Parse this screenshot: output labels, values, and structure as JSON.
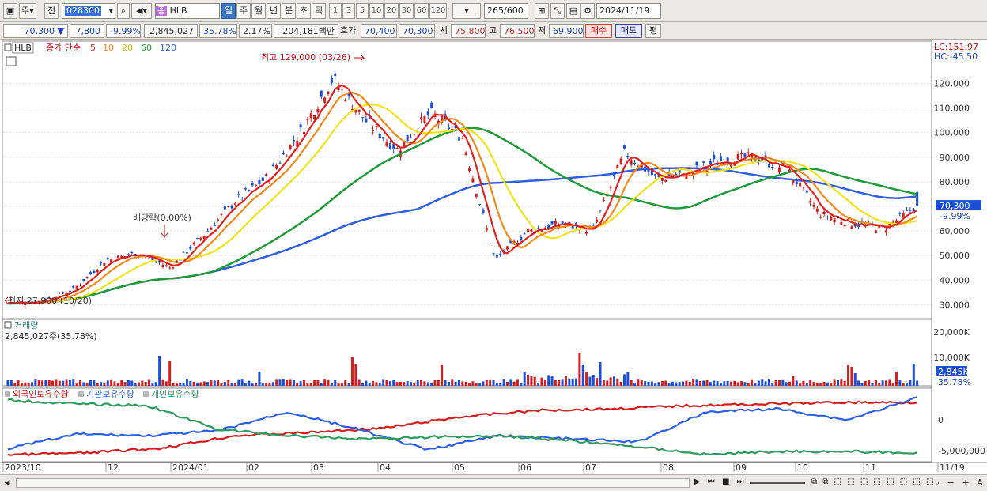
{
  "toolbar": {
    "period_select": "주",
    "prev_label": "전",
    "stock_code": "028300",
    "stock_badge": "종",
    "stock_name": "HLB",
    "tabs": [
      "일",
      "주",
      "월",
      "년",
      "분",
      "초",
      "틱"
    ],
    "active_tab": "일",
    "intervals": [
      "1",
      "3",
      "5",
      "10",
      "20",
      "30",
      "60",
      "120"
    ],
    "count": "265",
    "count_total": "/600",
    "date": "2024/11/19"
  },
  "quote": {
    "price": "70,300",
    "change": "7,800",
    "change_pct": "-9.99%",
    "volume": "2,845,027",
    "vol_ratio": "35.78%",
    "turnover_rate": "2.17%",
    "amount": "204,181백만",
    "bid_label": "호가",
    "bid1": "70,400",
    "bid2": "70,300",
    "open_label": "시",
    "open": "75,800",
    "high_label": "고",
    "high": "76,500",
    "low_label": "저",
    "low": "69,900",
    "buy_label": "매수",
    "sell_label": "매도",
    "avg_label": "평"
  },
  "main_legend": {
    "name": "HLB",
    "ma_title": "종가 단순",
    "ma_periods": [
      "5",
      "10",
      "20",
      "60",
      "120"
    ]
  },
  "colors": {
    "up": "#d21e1e",
    "down": "#1b4fd8",
    "ma5": "#e02020",
    "ma10": "#f08a1a",
    "ma20": "#f2e21a",
    "ma60": "#1f9a3a",
    "ma120": "#2f5fe0",
    "foreign": "#d21e1e",
    "inst": "#2f5fe0",
    "indiv": "#2e9a5e"
  },
  "annotations": {
    "high": "최고 129,000 (03/26)",
    "low": "최저 27,900 (10/20)",
    "dividend": "배당락(0.00%)"
  },
  "price_axis": {
    "lc": "LC:151.97",
    "hc": "HC:-45.50",
    "ticks": [
      "120,000",
      "110,000",
      "100,000",
      "90,000",
      "80,000",
      "70,000",
      "60,000",
      "50,000",
      "40,000",
      "30,000"
    ],
    "current": "70,300",
    "current_pct": "-9.99%"
  },
  "volume_panel": {
    "title": "거래량",
    "value": "2,845,027주(35.78%)",
    "ticks": [
      "20,000K",
      "10,000K"
    ],
    "current": "2,845K",
    "current_pct": "35.78%"
  },
  "holding_panel": {
    "legend": [
      "외국인보유수량",
      "기관보유수량",
      "개인보유수량"
    ],
    "ticks": [
      "0",
      "-5,000,000"
    ]
  },
  "x_axis": [
    "2023/10",
    "12",
    "2024/01",
    "02",
    "03",
    "04",
    "05",
    "06",
    "07",
    "08",
    "09",
    "10",
    "11",
    "11/19"
  ],
  "chart_data": {
    "type": "line",
    "title": "HLB",
    "series_type": "candlestick",
    "ylim": [
      25000,
      133000
    ],
    "high": {
      "value": 129000,
      "date": "03/26"
    },
    "low": {
      "value": 27900,
      "date": "10/20"
    },
    "close_path": [
      [
        "2023/10",
        30500
      ],
      [
        "2023/11",
        31500
      ],
      [
        "2023/12",
        36000
      ],
      [
        "2023/12-b",
        48000
      ],
      [
        "2024/01",
        51000
      ],
      [
        "2024/01-b",
        45000
      ],
      [
        "2024/02",
        58000
      ],
      [
        "2024/02-b",
        72000
      ],
      [
        "2024/03",
        82000
      ],
      [
        "2024/03-b",
        100000
      ],
      [
        "2024/03/26",
        122000
      ],
      [
        "2024/04",
        105000
      ],
      [
        "2024/04-b",
        93000
      ],
      [
        "2024/05",
        108000
      ],
      [
        "2024/05-b",
        98000
      ],
      [
        "2024/05/17",
        48000
      ],
      [
        "2024/06",
        60000
      ],
      [
        "2024/06-b",
        63000
      ],
      [
        "2024/07",
        60000
      ],
      [
        "2024/07-b",
        92000
      ],
      [
        "2024/08",
        81000
      ],
      [
        "2024/08-b",
        84000
      ],
      [
        "2024/09",
        89000
      ],
      [
        "2024/09-b",
        90000
      ],
      [
        "2024/10",
        85000
      ],
      [
        "2024/10-b",
        67000
      ],
      [
        "2024/11",
        63000
      ],
      [
        "2024/11-b",
        61000
      ],
      [
        "2024/11/19",
        70300
      ]
    ]
  }
}
